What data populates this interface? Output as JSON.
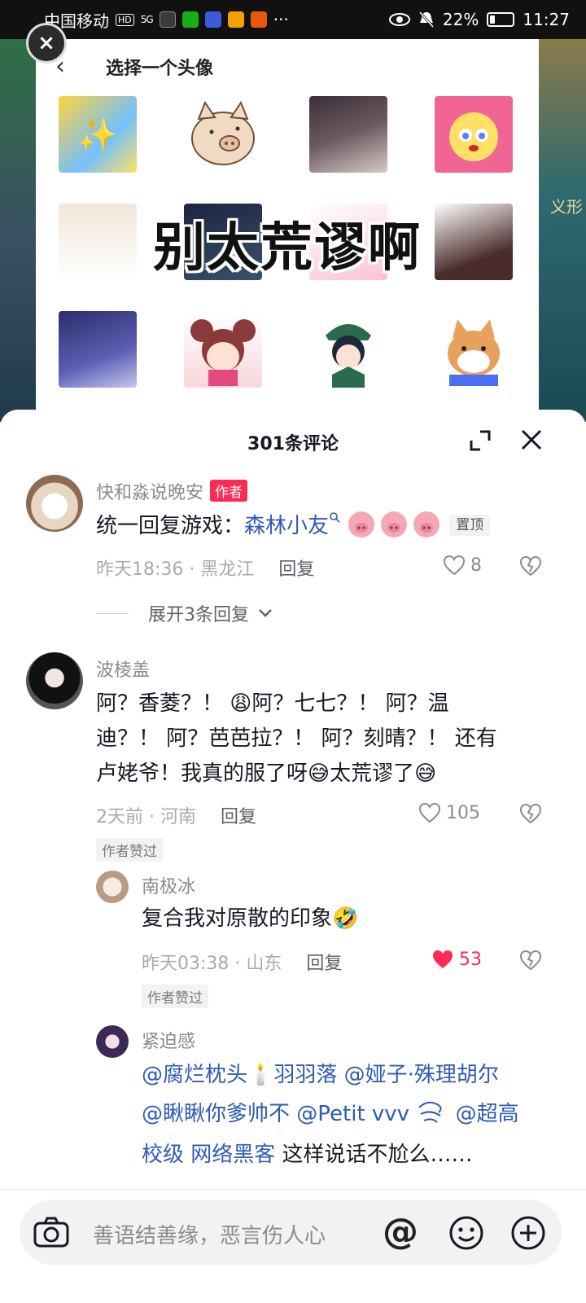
{
  "status_bar": {
    "carrier": "中国移动",
    "hd": "HD",
    "network": "5G",
    "battery": "22%",
    "battery_level": 0.22,
    "time": "11:27"
  },
  "avatar_picker": {
    "title": "选择一个头像",
    "close_glyph": "×",
    "back_glyph": "‹",
    "overlay_caption": "别太荒谬啊",
    "background_side_text": "义形"
  },
  "comments_sheet": {
    "title": "301条评论",
    "comments": [
      {
        "name": "快和淼说晚安",
        "badge": "作者",
        "text_prefix": "统一回复游戏：",
        "mention": "森林小友",
        "pin": "置顶",
        "time_location": "昨天18:36 · 黑龙江",
        "reply": "回复",
        "likes": "8",
        "expand": "展开3条回复"
      },
      {
        "name": "波棱盖",
        "lines": [
          "阿？香菱？！ 😩阿？七七？！ 阿？温",
          "迪？！ 阿？芭芭拉？！ 阿？刻晴？！ 还有",
          "卢姥爷！我真的服了呀😅太荒谬了😅"
        ],
        "time_location": "2天前 · 河南",
        "reply": "回复",
        "likes": "105",
        "author_liked": "作者赞过"
      }
    ],
    "replies": [
      {
        "name": "南极冰",
        "text": "复合我对原散的印象🤣",
        "time_location": "昨天03:38 · 山东",
        "reply": "回复",
        "likes": "53",
        "author_liked": "作者赞过"
      },
      {
        "name": "紧迫感",
        "line1_mention1": "@腐烂枕头🕯️羽羽落",
        "line1_mention2": "@娅子·殊理胡尔",
        "line2_mention1": "@瞅瞅你爹帅不",
        "line2_mention2": "@Petit vvv",
        "line2_mention3": "@超高",
        "line3_mention": "校级 网络黑客",
        "line3_text": " 这样说话不尬么……"
      }
    ]
  },
  "input_bar": {
    "placeholder": "善语结善缘，恶言伤人心",
    "at_glyph": "@"
  }
}
